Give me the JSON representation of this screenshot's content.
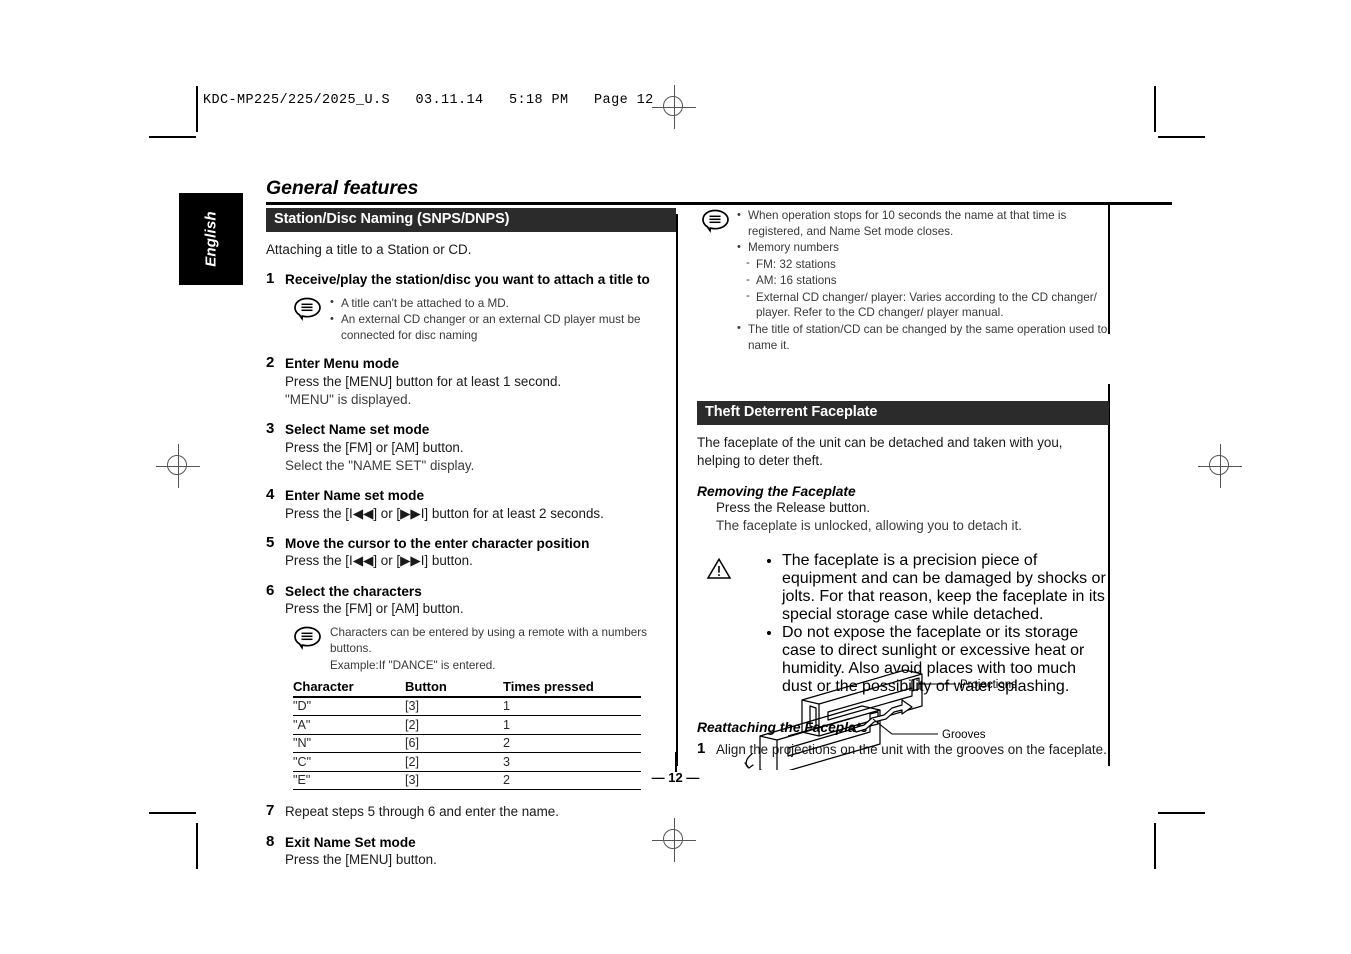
{
  "prepress": {
    "slug": "KDC-MP225/225/2025_U.S   03.11.14   5:18 PM   Page 12"
  },
  "document": {
    "title": "General features",
    "language_tab": "English",
    "page_number": "— 12 —"
  },
  "left_column": {
    "section": {
      "heading": "Station/Disc Naming (SNPS/DNPS)",
      "intro": "Attaching a title to a Station or CD."
    },
    "steps": [
      {
        "num": "1",
        "title": "Receive/play the station/disc you want to attach a title to",
        "note": {
          "icon": "memo-bubble-icon",
          "items": [
            "A title can't be attached to a MD.",
            "An external CD changer or an external CD player must be connected for disc naming"
          ]
        }
      },
      {
        "num": "2",
        "title": "Enter Menu mode",
        "lines": [
          "Press the [MENU] button for at least 1 second.",
          "\"MENU\" is displayed."
        ]
      },
      {
        "num": "3",
        "title": "Select Name set mode",
        "lines": [
          "Press the [FM] or [AM] button.",
          "Select the \"NAME SET\" display."
        ]
      },
      {
        "num": "4",
        "title": "Enter Name set mode",
        "lines": [
          "Press the [I◀◀] or [▶▶I] button for at least 2 seconds."
        ]
      },
      {
        "num": "5",
        "title": "Move the cursor to the enter character position",
        "lines": [
          "Press the [I◀◀] or [▶▶I] button."
        ]
      },
      {
        "num": "6",
        "title": "Select the characters",
        "lines": [
          "Press the [FM] or [AM] button."
        ],
        "note": {
          "icon": "memo-bubble-icon",
          "items": [
            "Characters can be entered by using a remote with a numbers buttons."
          ],
          "example": "Example:If \"DANCE\" is entered."
        }
      },
      {
        "num": "7",
        "title": "",
        "plain": "Repeat steps 5 through 6 and enter the name."
      },
      {
        "num": "8",
        "title": "Exit Name Set mode",
        "lines": [
          "Press the [MENU] button."
        ]
      }
    ],
    "character_table": {
      "headers": [
        "Character",
        "Button",
        "Times pressed"
      ],
      "rows": [
        [
          "\"D\"",
          "[3]",
          "1"
        ],
        [
          "\"A\"",
          "[2]",
          "1"
        ],
        [
          "\"N\"",
          "[6]",
          "2"
        ],
        [
          "\"C\"",
          "[2]",
          "3"
        ],
        [
          "\"E\"",
          "[3]",
          "2"
        ]
      ]
    }
  },
  "right_column": {
    "top_note": {
      "icon": "memo-bubble-icon",
      "items": [
        "When operation stops for 10 seconds the name at that time is registered, and Name Set mode closes.",
        "Memory numbers"
      ],
      "sub_items": [
        "FM: 32 stations",
        "AM: 16 stations",
        "External CD changer/ player: Varies according to the CD changer/ player. Refer to the CD changer/ player manual."
      ],
      "last_item": "The title of station/CD can be changed by the same operation used to name it."
    },
    "section": {
      "heading": "Theft Deterrent Faceplate",
      "intro": "The faceplate of the unit can be detached and taken with you, helping to deter theft."
    },
    "removing": {
      "subhead": "Removing the Faceplate",
      "lines": [
        "Press the Release button.",
        "The faceplate is unlocked, allowing you to detach it."
      ],
      "caution": {
        "icon": "warning-triangle-icon",
        "items": [
          "The faceplate is a precision piece of equipment and can be damaged by shocks or jolts. For that reason, keep the faceplate in its special storage case while detached.",
          "Do not expose the faceplate or its storage case to direct sunlight or excessive heat or humidity. Also avoid places with too much dust or the possibility of water splashing."
        ]
      }
    },
    "reattaching": {
      "subhead": "Reattaching the Faceplate",
      "step_num": "1",
      "step_text": "Align the projections on the unit with the grooves on the faceplate.",
      "diagram": {
        "name": "faceplate-attach-diagram",
        "callouts": [
          "Projections",
          "Grooves"
        ]
      }
    }
  }
}
